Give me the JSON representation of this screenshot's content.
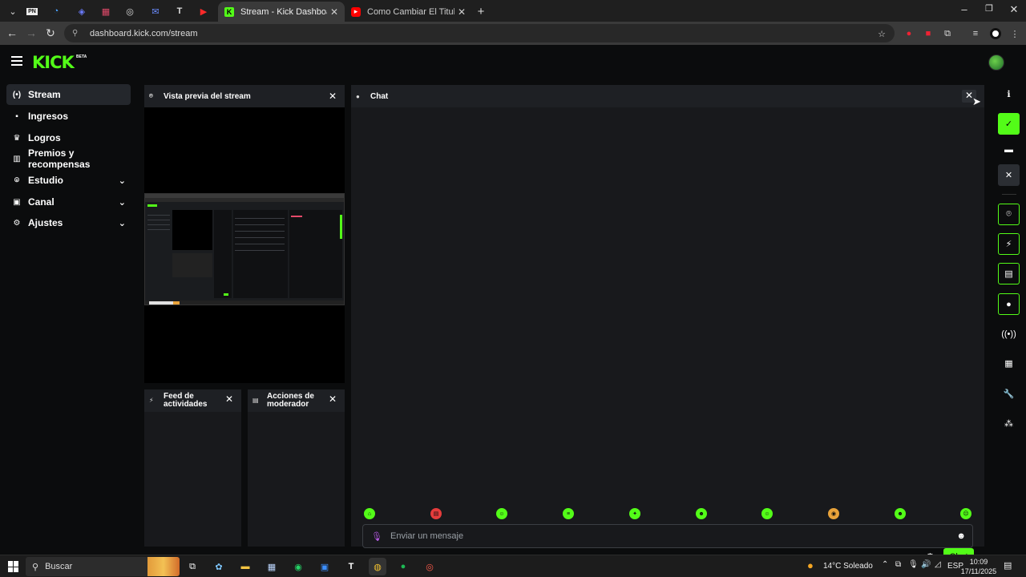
{
  "browser": {
    "tabs": [
      {
        "title": "Stream - Kick Dashboard",
        "active": true
      },
      {
        "title": "Como Cambiar El Titulo De Mi",
        "active": false
      }
    ],
    "url": "dashboard.kick.com/stream"
  },
  "header": {
    "logo": "KICK",
    "logo_badge": "BETA"
  },
  "sidebar": {
    "items": [
      {
        "label": "Stream",
        "icon": "stream-icon",
        "glyph": "(•)",
        "active": true,
        "expandable": false
      },
      {
        "label": "Ingresos",
        "icon": "income-icon",
        "glyph": "▪",
        "active": false,
        "expandable": false
      },
      {
        "label": "Logros",
        "icon": "trophy-icon",
        "glyph": "♛",
        "active": false,
        "expandable": false
      },
      {
        "label": "Premios y recompensas",
        "icon": "rewards-icon",
        "glyph": "▥",
        "active": false,
        "expandable": false
      },
      {
        "label": "Estudio",
        "icon": "studio-icon",
        "glyph": "⌾",
        "active": false,
        "expandable": true
      },
      {
        "label": "Canal",
        "icon": "channel-icon",
        "glyph": "▣",
        "active": false,
        "expandable": true
      },
      {
        "label": "Ajustes",
        "icon": "gear-icon",
        "glyph": "⚙",
        "active": false,
        "expandable": true
      }
    ]
  },
  "panels": {
    "preview": {
      "title": "Vista previa del stream"
    },
    "activity": {
      "title": "Feed de actividades"
    },
    "moderator": {
      "title": "Acciones de moderador"
    },
    "chat": {
      "title": "Chat",
      "input_placeholder": "Enviar un mensaje",
      "send_label": "Chat",
      "emotes": [
        {
          "name": "emote-1",
          "color": "#53fc18",
          "glyph": "⌂"
        },
        {
          "name": "emote-2",
          "color": "#e63c3c",
          "glyph": "▤"
        },
        {
          "name": "emote-3",
          "color": "#53fc18",
          "glyph": "☺"
        },
        {
          "name": "emote-4",
          "color": "#53fc18",
          "glyph": "≡"
        },
        {
          "name": "emote-5",
          "color": "#53fc18",
          "glyph": "✦"
        },
        {
          "name": "emote-6",
          "color": "#53fc18",
          "glyph": "☻"
        },
        {
          "name": "emote-7",
          "color": "#53fc18",
          "glyph": "☺"
        },
        {
          "name": "emote-8",
          "color": "#e8a23a",
          "glyph": "◉"
        },
        {
          "name": "emote-9",
          "color": "#53fc18",
          "glyph": "☻"
        },
        {
          "name": "emote-10",
          "color": "#53fc18",
          "glyph": "☹"
        }
      ]
    }
  },
  "taskbar": {
    "search_label": "Buscar",
    "weather": "14°C  Soleado",
    "language": "ESP",
    "time": "10:09",
    "date": "17/11/2025"
  },
  "colors": {
    "accent": "#53fc18",
    "panel": "#18191c",
    "background": "#0b0c0d"
  }
}
